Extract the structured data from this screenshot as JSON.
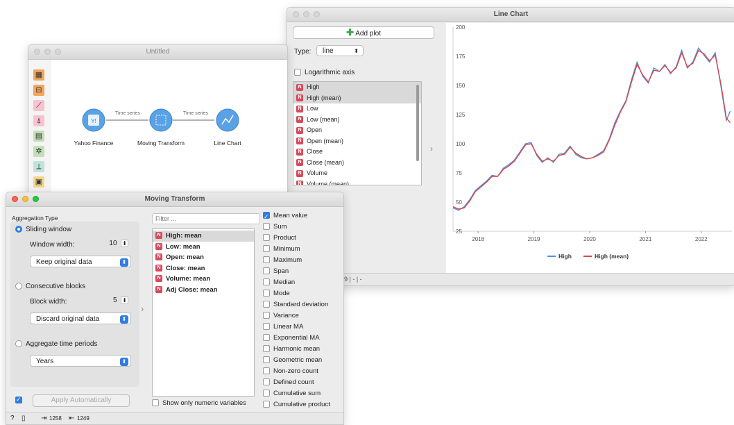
{
  "line_chart_window": {
    "title": "Line Chart",
    "add_plot_label": "Add plot",
    "type_label": "Type:",
    "type_value": "line",
    "log_axis_label": "Logarithmic axis",
    "variables": [
      {
        "name": "High",
        "selected": true
      },
      {
        "name": "High (mean)",
        "selected": true
      },
      {
        "name": "Low",
        "selected": false
      },
      {
        "name": "Low (mean)",
        "selected": false
      },
      {
        "name": "Open",
        "selected": false
      },
      {
        "name": "Open (mean)",
        "selected": false
      },
      {
        "name": "Close",
        "selected": false
      },
      {
        "name": "Close (mean)",
        "selected": false
      },
      {
        "name": "Volume",
        "selected": false
      },
      {
        "name": "Volume (mean)",
        "selected": false
      }
    ],
    "status_text": "9 | - | -"
  },
  "chart_data": {
    "type": "line",
    "x_ticks": [
      "2018",
      "2019",
      "2020",
      "2021",
      "2022"
    ],
    "y_ticks": [
      "25",
      "50",
      "75",
      "100",
      "125",
      "150",
      "175",
      "200"
    ],
    "ylim": [
      25,
      200
    ],
    "xlim": [
      2017.55,
      2022.55
    ],
    "grid": false,
    "legend": "bottom",
    "colors": {
      "High": "#4a90d9",
      "High (mean)": "#e0434a"
    },
    "x": [
      2017.55,
      2017.65,
      2017.75,
      2017.85,
      2017.95,
      2018.05,
      2018.15,
      2018.25,
      2018.35,
      2018.45,
      2018.55,
      2018.65,
      2018.75,
      2018.85,
      2018.95,
      2019.05,
      2019.15,
      2019.25,
      2019.35,
      2019.45,
      2019.55,
      2019.65,
      2019.75,
      2019.85,
      2019.95,
      2020.05,
      2020.15,
      2020.25,
      2020.35,
      2020.45,
      2020.55,
      2020.65,
      2020.75,
      2020.85,
      2020.95,
      2021.05,
      2021.15,
      2021.25,
      2021.35,
      2021.45,
      2021.55,
      2021.65,
      2021.75,
      2021.85,
      2021.95,
      2022.05,
      2022.15,
      2022.25,
      2022.35,
      2022.45,
      2022.52
    ],
    "series": [
      {
        "name": "High",
        "values": [
          45,
          43,
          46,
          52,
          60,
          64,
          68,
          73,
          72,
          79,
          82,
          86,
          93,
          100,
          101,
          90,
          84,
          88,
          84,
          91,
          92,
          98,
          91,
          88,
          87,
          88,
          91,
          94,
          104,
          118,
          128,
          137,
          155,
          170,
          158,
          152,
          165,
          162,
          168,
          160,
          166,
          180,
          165,
          170,
          182,
          176,
          170,
          178,
          150,
          120,
          128
        ]
      },
      {
        "name": "High (mean)",
        "values": [
          46,
          44,
          45,
          51,
          59,
          63,
          67,
          72,
          72,
          78,
          81,
          85,
          92,
          99,
          100,
          91,
          85,
          87,
          85,
          90,
          91,
          97,
          92,
          89,
          87,
          88,
          90,
          93,
          103,
          116,
          127,
          136,
          153,
          168,
          159,
          153,
          163,
          162,
          167,
          161,
          165,
          178,
          166,
          169,
          180,
          177,
          171,
          176,
          152,
          122,
          118
        ]
      }
    ]
  },
  "canvas_window": {
    "title": "Untitled",
    "nodes": [
      {
        "label": "Yahoo Finance"
      },
      {
        "label": "Moving Transform"
      },
      {
        "label": "Line Chart"
      }
    ],
    "links": [
      "Time series",
      "Time series"
    ]
  },
  "moving_transform_window": {
    "title": "Moving Transform",
    "aggregation_type_label": "Aggregation Type",
    "sliding_window_label": "Sliding window",
    "window_width_label": "Window width:",
    "window_width_value": "10",
    "keep_data_option": "Keep original data",
    "consecutive_blocks_label": "Consecutive blocks",
    "block_width_label": "Block width:",
    "block_width_value": "5",
    "discard_data_option": "Discard original data",
    "aggregate_periods_label": "Aggregate time periods",
    "period_option": "Years",
    "apply_label": "Apply Automatically",
    "filter_placeholder": "Filter ...",
    "transforms": [
      {
        "label": "High: mean",
        "selected": true
      },
      {
        "label": "Low: mean",
        "selected": false
      },
      {
        "label": "Open: mean",
        "selected": false
      },
      {
        "label": "Close: mean",
        "selected": false
      },
      {
        "label": "Volume: mean",
        "selected": false
      },
      {
        "label": "Adj Close: mean",
        "selected": false
      }
    ],
    "show_numeric_label": "Show only numeric variables",
    "aggregations": [
      {
        "label": "Mean value",
        "checked": true
      },
      {
        "label": "Sum",
        "checked": false
      },
      {
        "label": "Product",
        "checked": false
      },
      {
        "label": "Minimum",
        "checked": false
      },
      {
        "label": "Maximum",
        "checked": false
      },
      {
        "label": "Span",
        "checked": false
      },
      {
        "label": "Median",
        "checked": false
      },
      {
        "label": "Mode",
        "checked": false
      },
      {
        "label": "Standard deviation",
        "checked": false
      },
      {
        "label": "Variance",
        "checked": false
      },
      {
        "label": "Linear MA",
        "checked": false
      },
      {
        "label": "Exponential MA",
        "checked": false
      },
      {
        "label": "Harmonic mean",
        "checked": false
      },
      {
        "label": "Geometric mean",
        "checked": false
      },
      {
        "label": "Non-zero count",
        "checked": false
      },
      {
        "label": "Defined count",
        "checked": false
      },
      {
        "label": "Cumulative sum",
        "checked": false
      },
      {
        "label": "Cumulative product",
        "checked": false
      }
    ],
    "status_in": "1258",
    "status_out": "1249"
  }
}
